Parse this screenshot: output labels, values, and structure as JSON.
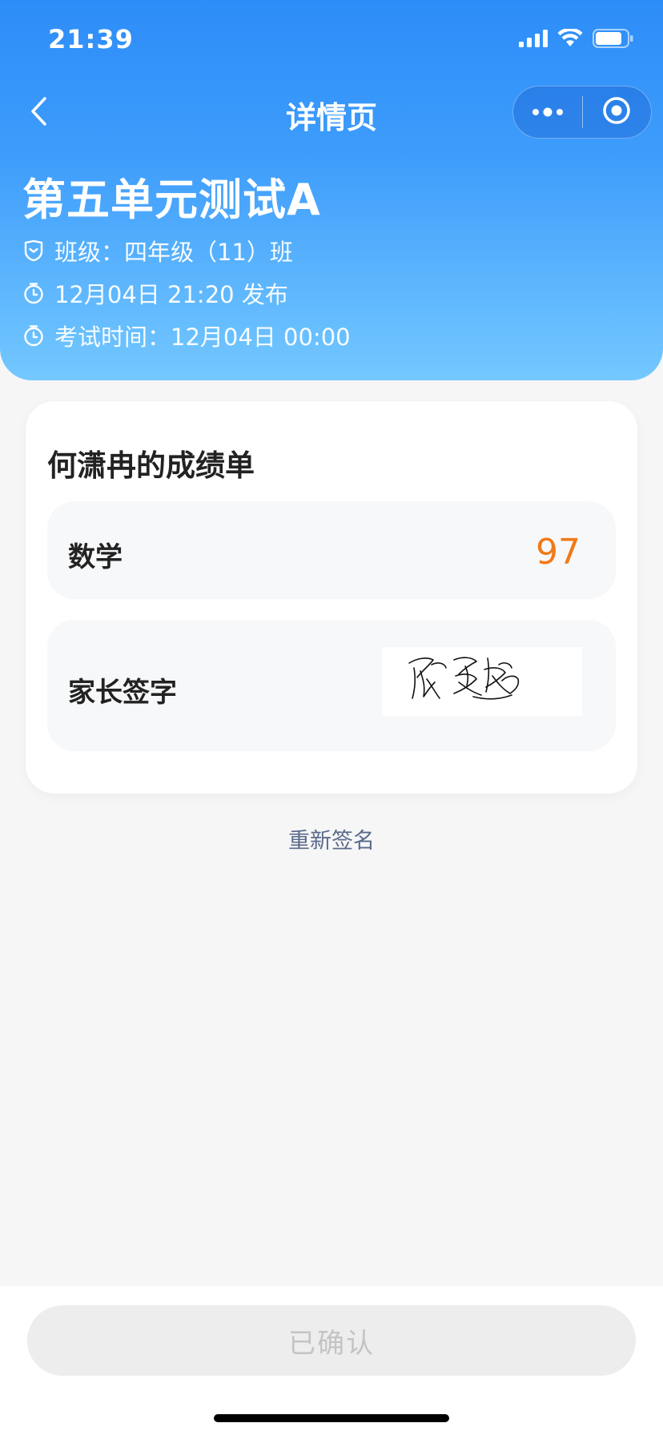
{
  "status_bar": {
    "time": "21:39",
    "icons": [
      "signal-icon",
      "wifi-icon",
      "battery-icon"
    ]
  },
  "nav": {
    "title": "详情页",
    "back_icon": "chevron-left-icon",
    "more_icon": "more-dots-icon",
    "close_icon": "mini-program-close-icon"
  },
  "exam": {
    "title": "第五单元测试A",
    "class_text": "班级：四年级（11）班",
    "publish_text": "12月04日 21:20 发布",
    "exam_time_text": "考试时间：12月04日 00:00"
  },
  "report": {
    "title": "何潇冉的成绩单",
    "subject_label": "数学",
    "score": "97",
    "signature_label": "家长签字",
    "signature_name": "贺爱超"
  },
  "actions": {
    "resign_label": "重新签名",
    "confirm_label": "已确认"
  },
  "colors": {
    "header_gradient_top": "#2d8df8",
    "header_gradient_bottom": "#74c8ff",
    "score": "#f07a18",
    "link": "#5a6a8a"
  }
}
